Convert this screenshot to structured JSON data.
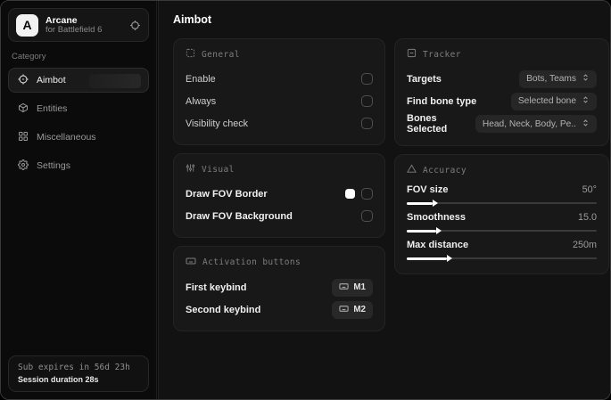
{
  "app": {
    "logo_letter": "A",
    "name": "Arcane",
    "subtitle": "for Battlefield 6"
  },
  "sidebar": {
    "category_label": "Category",
    "items": [
      {
        "label": "Aimbot",
        "icon": "crosshair-icon",
        "active": true
      },
      {
        "label": "Entities",
        "icon": "cube-icon",
        "active": false
      },
      {
        "label": "Miscellaneous",
        "icon": "grid-icon",
        "active": false
      },
      {
        "label": "Settings",
        "icon": "gear-icon",
        "active": false
      }
    ],
    "footer": {
      "sub_expiry": "Sub expires in 56d 23h",
      "session_duration": "Session duration 28s"
    }
  },
  "main": {
    "title": "Aimbot",
    "general": {
      "title": "General",
      "rows": [
        {
          "label": "Enable",
          "checked": false
        },
        {
          "label": "Always",
          "checked": false
        },
        {
          "label": "Visibility check",
          "checked": false
        }
      ]
    },
    "visual": {
      "title": "Visual",
      "rows": [
        {
          "label": "Draw FOV Border",
          "swatch_color": "#ffffff",
          "checked": false
        },
        {
          "label": "Draw FOV Background",
          "checked": false
        }
      ]
    },
    "activation": {
      "title": "Activation buttons",
      "rows": [
        {
          "label": "First keybind",
          "key": "M1"
        },
        {
          "label": "Second keybind",
          "key": "M2"
        }
      ]
    },
    "tracker": {
      "title": "Tracker",
      "rows": [
        {
          "label": "Targets",
          "value": "Bots, Teams"
        },
        {
          "label": "Find bone type",
          "value": "Selected bone"
        },
        {
          "label": "Bones Selected",
          "value": "Head, Neck, Body, Pe.."
        }
      ]
    },
    "accuracy": {
      "title": "Accuracy",
      "sliders": [
        {
          "label": "FOV size",
          "value": "50°",
          "percent": 13.5
        },
        {
          "label": "Smoothness",
          "value": "15.0",
          "percent": 15.5
        },
        {
          "label": "Max distance",
          "value": "250m",
          "percent": 21
        }
      ]
    }
  },
  "colors": {
    "fov_border_swatch": "#ffffff",
    "accent": "#ffffff",
    "card_background": "#181818"
  }
}
